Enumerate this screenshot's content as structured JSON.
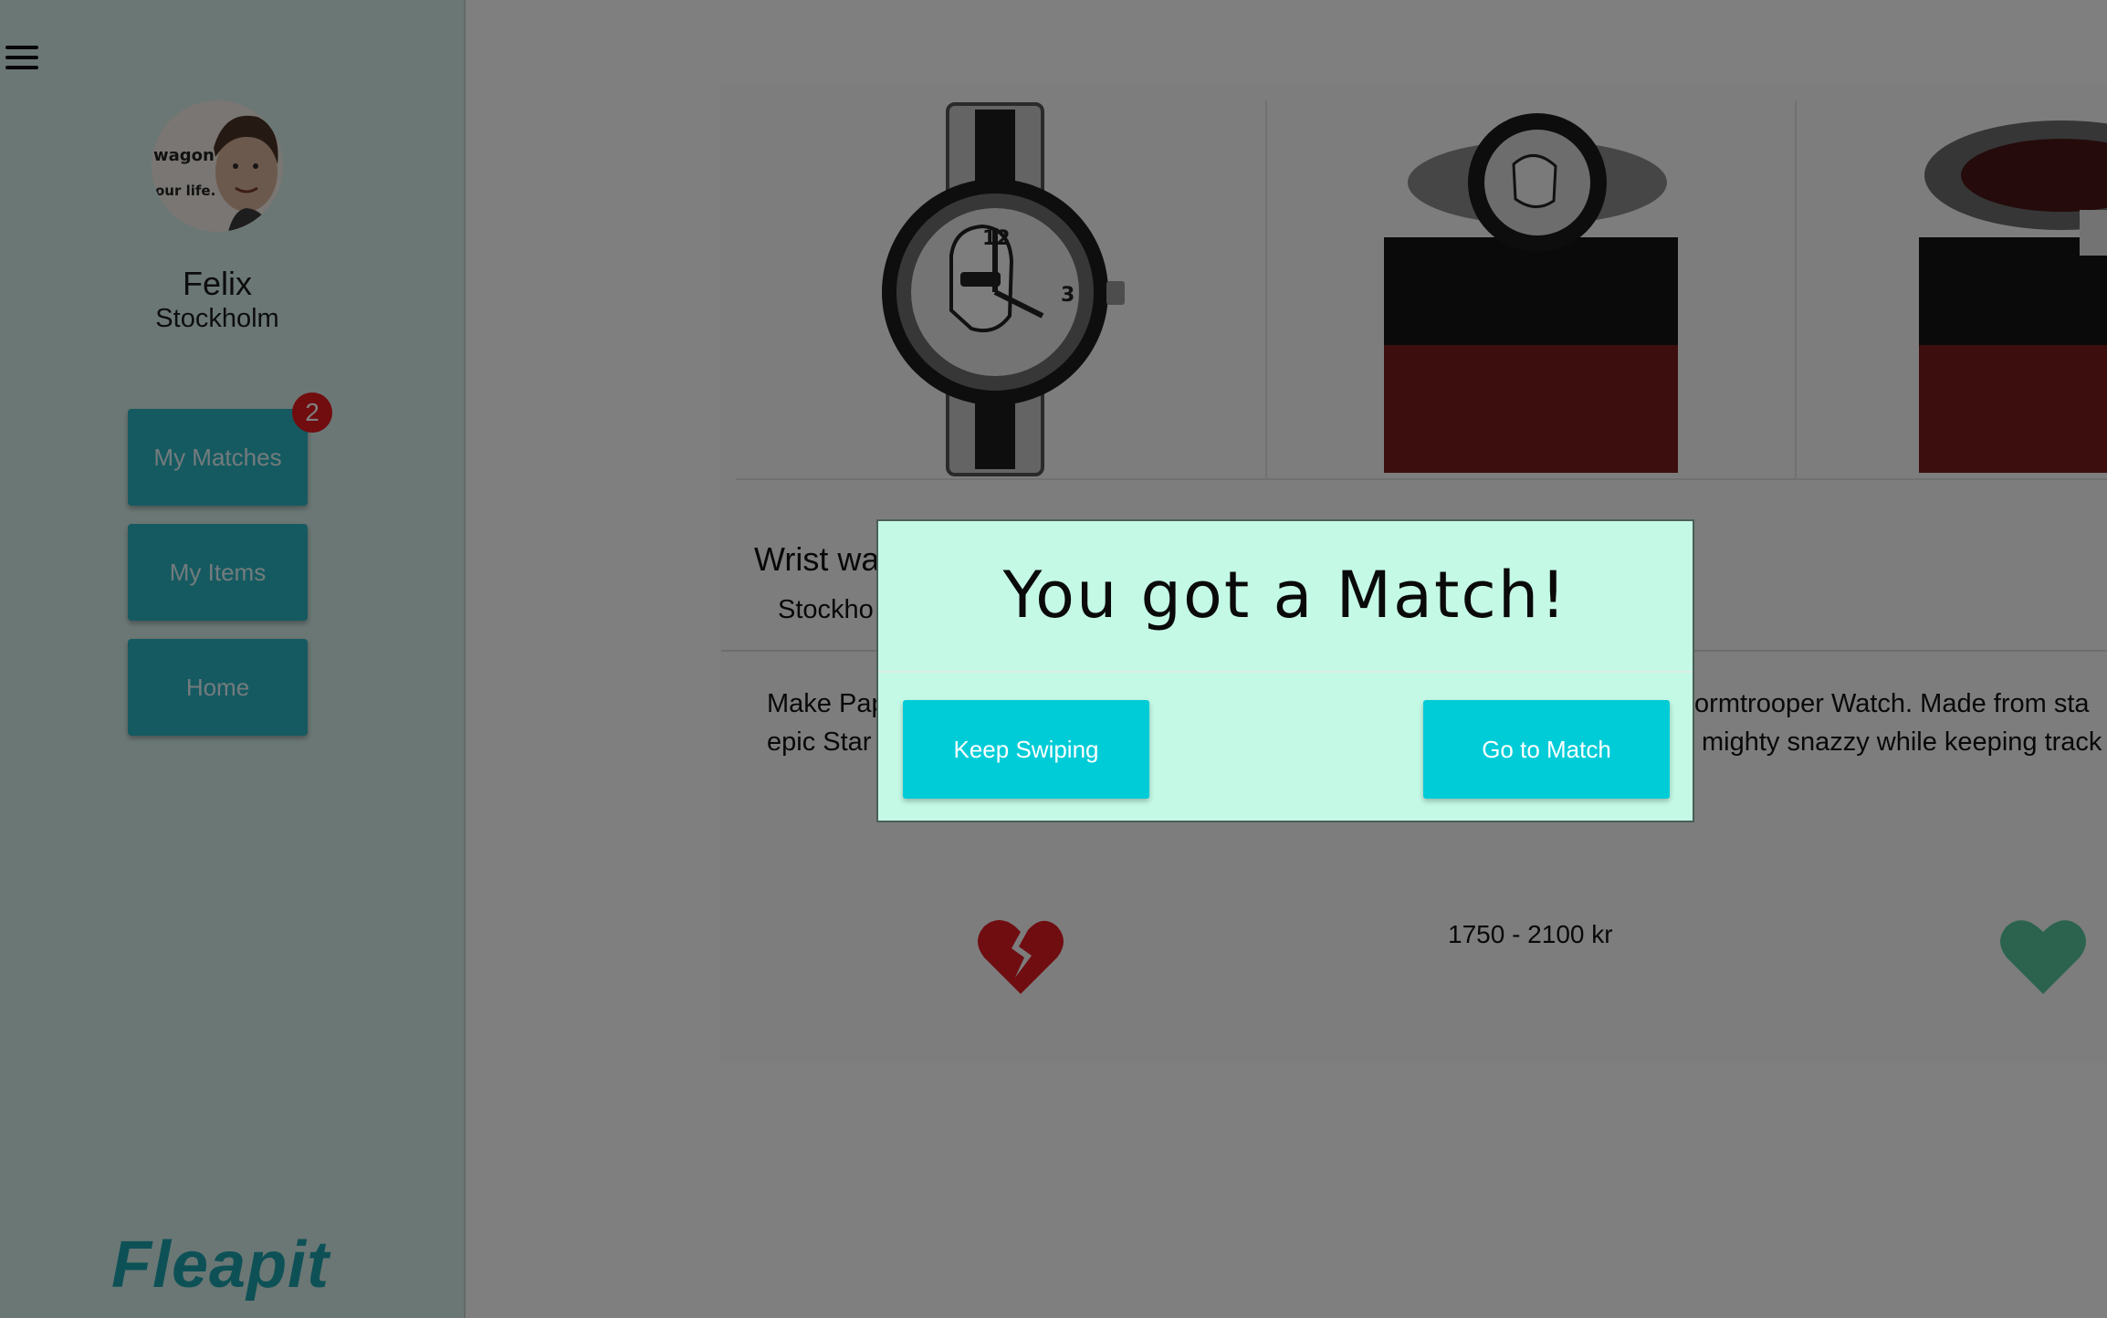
{
  "sidebar": {
    "user": {
      "name": "Felix",
      "city": "Stockholm"
    },
    "nav": {
      "my_matches": "My Matches",
      "my_matches_badge": "2",
      "my_items": "My Items",
      "home": "Home"
    },
    "logo": "Fleapit"
  },
  "item": {
    "title": "Wrist wa",
    "city": "Stockho",
    "description_lines": [
      {
        "left": "Make Pap",
        "right": "tormtrooper Watch. Made from sta"
      },
      {
        "left": "epic Star",
        "right": "mighty snazzy while keeping track"
      }
    ],
    "price": "1750 - 2100 kr"
  },
  "modal": {
    "title": "You got a Match!",
    "keep_swiping": "Keep Swiping",
    "go_to_match": "Go to Match"
  },
  "colors": {
    "accent": "#2bb4c2",
    "modal_bg": "#c4f9e6",
    "modal_button": "#00ccd8",
    "badge": "#e2191f",
    "dislike": "#e01b23",
    "like": "#56c79c",
    "logo": "#1aa3ad"
  },
  "icons": {
    "menu": "hamburger-menu-icon",
    "dislike": "broken-heart-icon",
    "like": "heart-icon"
  }
}
